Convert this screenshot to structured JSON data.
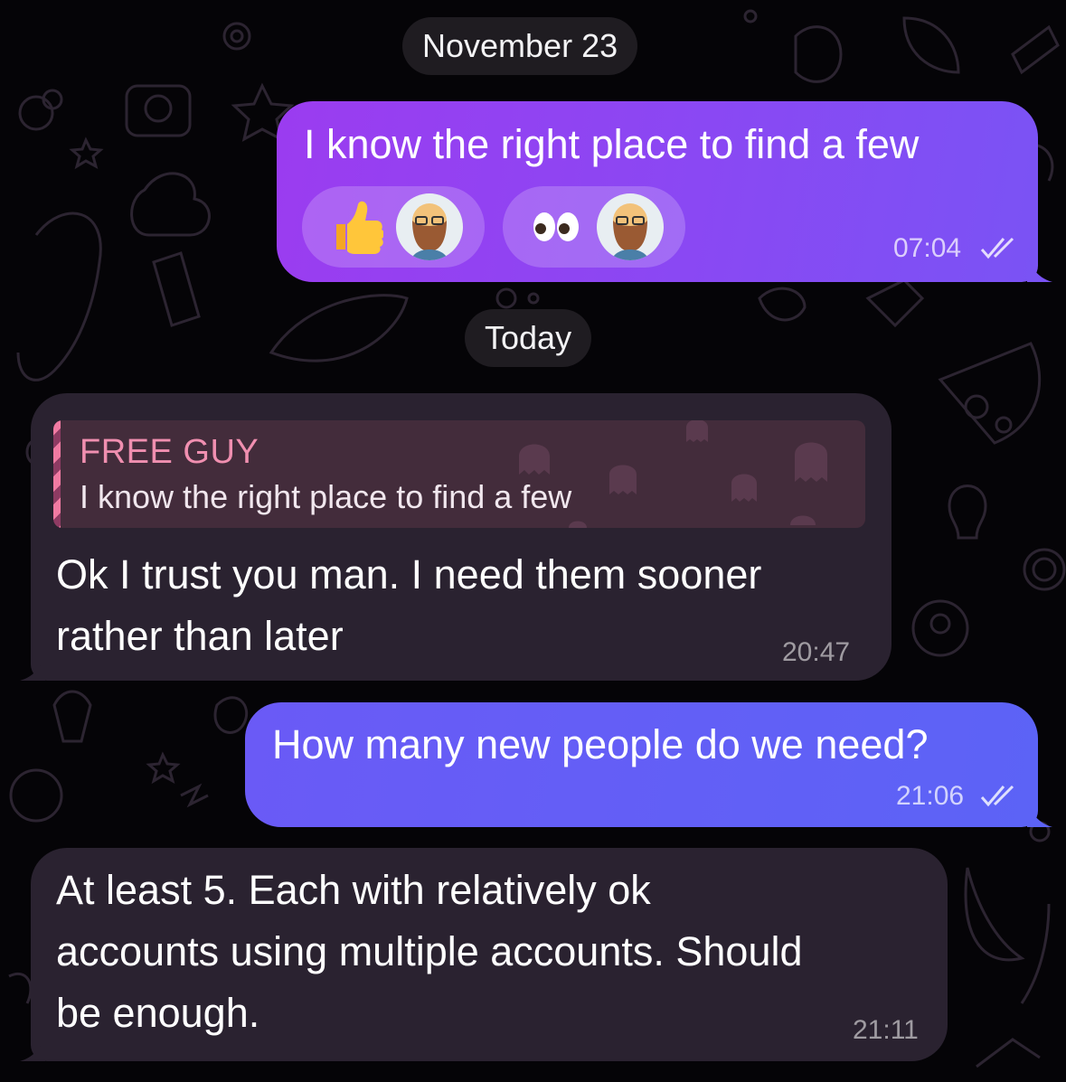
{
  "chat": {
    "date_separators": [
      "November 23",
      "Today"
    ],
    "messages": [
      {
        "direction": "outgoing",
        "text": "I know the right place to find a few",
        "time": "07:04",
        "status": "read-double-check",
        "reactions": [
          {
            "emoji": "👍",
            "icon": "thumbs-up-icon",
            "reactor_avatar": "bearded-man-avatar"
          },
          {
            "emoji": "👀",
            "icon": "eyes-icon",
            "reactor_avatar": "bearded-man-avatar"
          }
        ]
      },
      {
        "direction": "incoming",
        "reply_to": {
          "name": "FREE GUY",
          "text": "I know the right place to find a few"
        },
        "lines": [
          "Ok I trust you man. I need them sooner",
          "rather than later"
        ],
        "time": "20:47"
      },
      {
        "direction": "outgoing",
        "text": "How many new people do we need?",
        "time": "21:06",
        "status": "read-double-check"
      },
      {
        "direction": "incoming",
        "lines": [
          "At least 5. Each with relatively ok",
          "accounts using multiple accounts. Should",
          "be enough."
        ],
        "time": "21:11"
      }
    ]
  },
  "colors": {
    "background": "#050407",
    "outgoing_bubble_top": "#8a48f3",
    "outgoing_bubble_bottom": "#5c63f6",
    "incoming_bubble": "#2a2230",
    "reply_name": "#f08fb0",
    "doodle_pattern": "#2b2430"
  }
}
